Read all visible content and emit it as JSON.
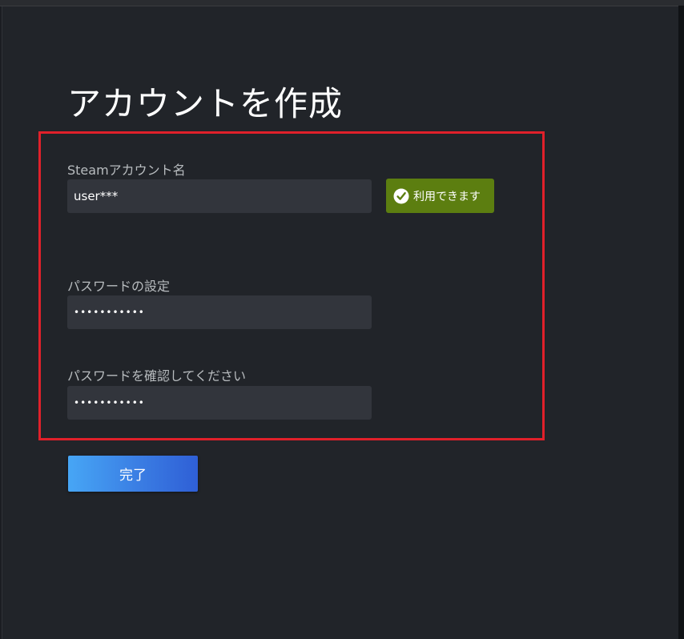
{
  "page": {
    "title": "アカウントを作成"
  },
  "form": {
    "account_name": {
      "label": "Steamアカウント名",
      "value": "user***"
    },
    "availability": {
      "text": "利用できます",
      "icon": "check-circle-icon",
      "color": "#5c7e10"
    },
    "password": {
      "label": "パスワードの設定",
      "value": "•••••••••••"
    },
    "password_confirm": {
      "label": "パスワードを確認してください",
      "value": "•••••••••••"
    },
    "done_button": {
      "label": "完了"
    }
  },
  "colors": {
    "background": "#212429",
    "input_background": "#32353c",
    "highlight_border": "#e0202a",
    "button_gradient_start": "#47a6f5",
    "button_gradient_end": "#2f5fd6"
  }
}
